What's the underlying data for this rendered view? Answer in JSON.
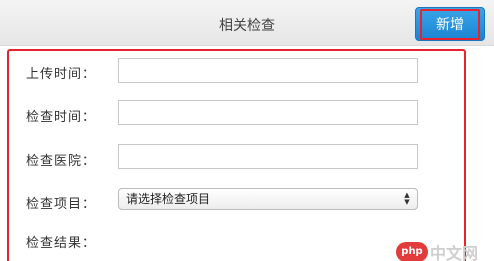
{
  "header": {
    "title": "相关检查",
    "add_button_label": "新增"
  },
  "form": {
    "upload_time": {
      "label": "上传时间：",
      "value": ""
    },
    "exam_time": {
      "label": "检查时间：",
      "value": ""
    },
    "exam_hospital": {
      "label": "检查医院：",
      "value": ""
    },
    "exam_item": {
      "label": "检查项目：",
      "selected": "请选择检查项目"
    },
    "exam_result": {
      "label": "检查结果："
    }
  },
  "watermark": {
    "logo": "php",
    "text": "中文网"
  },
  "colors": {
    "accent": "#1c84d2",
    "highlight": "#e8232f"
  }
}
